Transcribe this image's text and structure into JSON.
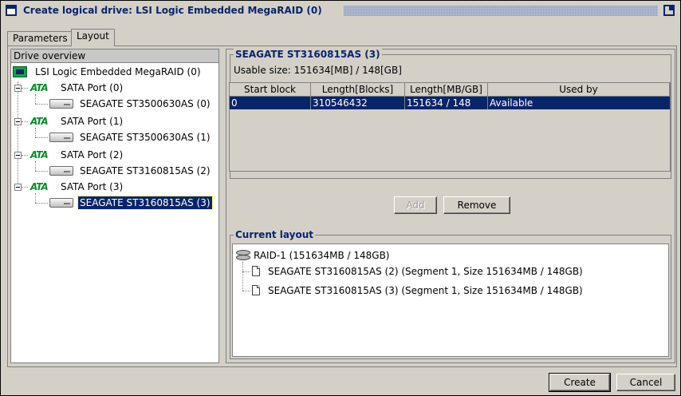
{
  "window": {
    "title": "Create logical drive: LSI Logic Embedded MegaRAID (0)"
  },
  "tabs": [
    {
      "label": "Parameters"
    },
    {
      "label": "Layout"
    }
  ],
  "drive_overview": {
    "header": "Drive overview",
    "controller": "LSI Logic Embedded MegaRAID (0)",
    "ports": [
      {
        "label": "SATA Port (0)",
        "disk": "SEAGATE ST3500630AS (0)"
      },
      {
        "label": "SATA Port (1)",
        "disk": "SEAGATE ST3500630AS (1)"
      },
      {
        "label": "SATA Port (2)",
        "disk": "SEAGATE ST3160815AS (2)"
      },
      {
        "label": "SATA Port (3)",
        "disk": "SEAGATE ST3160815AS (3)"
      }
    ],
    "selected_disk": "SEAGATE ST3160815AS (3)",
    "ata_icon_text": "ATA"
  },
  "disk_detail": {
    "title": "SEAGATE ST3160815AS (3)",
    "usable_size": "Usable size: 151634[MB] / 148[GB]",
    "columns": [
      "Start block",
      "Length[Blocks]",
      "Length[MB/GB]",
      "Used by"
    ],
    "rows": [
      [
        "0",
        "310546432",
        "151634 / 148",
        "Available"
      ]
    ]
  },
  "actions": {
    "add_label": "Add",
    "remove_label": "Remove"
  },
  "current_layout": {
    "title": "Current layout",
    "raid": "RAID-1 (151634MB / 148GB)",
    "members": [
      "SEAGATE ST3160815AS (2) (Segment 1, Size 151634MB / 148GB)",
      "SEAGATE ST3160815AS (3) (Segment 1, Size 151634MB / 148GB)"
    ]
  },
  "footer": {
    "create_label": "Create",
    "cancel_label": "Cancel"
  }
}
